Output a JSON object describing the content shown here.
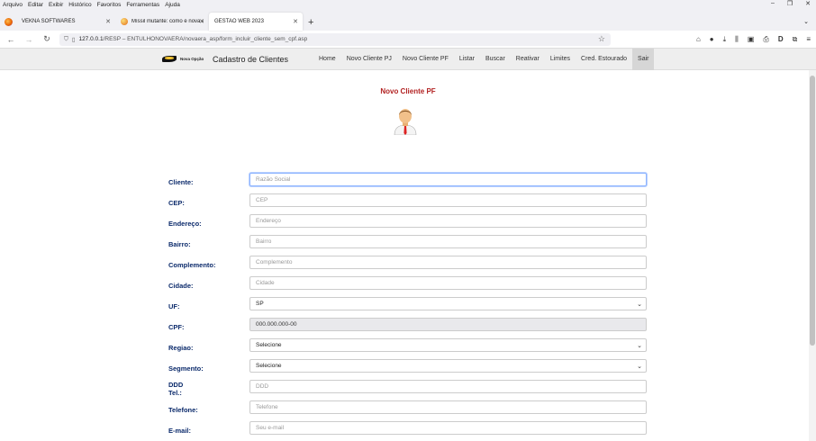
{
  "menubar": [
    "Arquivo",
    "Editar",
    "Exibir",
    "Histórico",
    "Favoritos",
    "Ferramentas",
    "Ajuda"
  ],
  "tabs": [
    {
      "title": "VEKNA SOFTWARES",
      "active": false
    },
    {
      "title": "Míssil mutante: como é nova ar",
      "active": false
    },
    {
      "title": "GESTAO WEB 2023",
      "active": true
    }
  ],
  "url": {
    "host": "127.0.0.1",
    "path": "/RESP – ENTULHONOVAERA/novaera_asp/form_incluir_cliente_sem_cpf.asp"
  },
  "header": {
    "brand": "Nova Opção",
    "title": "Cadastro de Clientes",
    "menu": [
      "Home",
      "Novo Cliente PJ",
      "Novo Cliente PF",
      "Listar",
      "Buscar",
      "Reativar",
      "Limites",
      "Cred. Estourado",
      "Sair"
    ]
  },
  "page_title": "Novo Cliente PF",
  "form": {
    "cliente": {
      "label": "Cliente:",
      "placeholder": "Razão Social"
    },
    "cep": {
      "label": "CEP:",
      "placeholder": "CEP"
    },
    "endereco": {
      "label": "Endereço:",
      "placeholder": "Endereço"
    },
    "bairro": {
      "label": "Bairro:",
      "placeholder": "Bairro"
    },
    "complemento": {
      "label": "Complemento:",
      "placeholder": "Complemento"
    },
    "cidade": {
      "label": "Cidade:",
      "placeholder": "Cidade"
    },
    "uf": {
      "label": "UF:",
      "value": "SP"
    },
    "cpf": {
      "label": "CPF:",
      "value": "000.000.000-00"
    },
    "regiao": {
      "label": "Regiao:",
      "value": "Selecione"
    },
    "segmento": {
      "label": "Segmento:",
      "value": "Selecione"
    },
    "ddd": {
      "label": "DDD",
      "label2": "Tel.:",
      "placeholder": "DDD"
    },
    "telefone": {
      "label": "Telefone:",
      "placeholder": "Telefone"
    },
    "email": {
      "label": "E-mail:",
      "placeholder": "Seu e-mail"
    }
  }
}
